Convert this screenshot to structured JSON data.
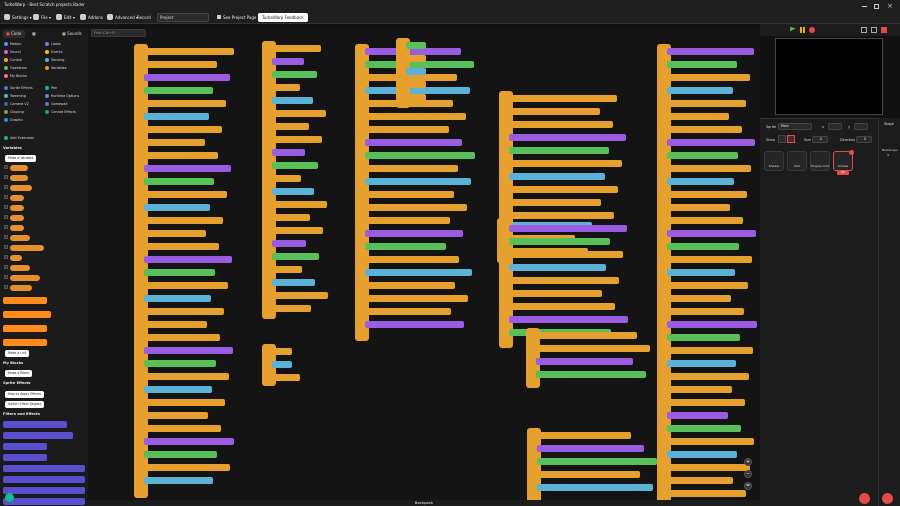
{
  "menubar": {
    "logo": "TurboWarp - Best Scratch projects Bader",
    "settings": "Settings",
    "file": "File",
    "edit": "Edit",
    "addons": "Addons",
    "advanced": "Advanced",
    "record": "Record",
    "project_title": "Project",
    "see_project_page": "See Project Page",
    "feedback": "TurboWarp Feedback"
  },
  "tabs": {
    "code": "Code",
    "costumes": "Costumes",
    "sounds": "Sounds"
  },
  "categories": [
    {
      "label": "Motion",
      "color": "#4c97ff"
    },
    {
      "label": "Looks",
      "color": "#9966ff"
    },
    {
      "label": "Sound",
      "color": "#cf63cf"
    },
    {
      "label": "Events",
      "color": "#ffbf00"
    },
    {
      "label": "Control",
      "color": "#ffab19"
    },
    {
      "label": "Sensing",
      "color": "#5cb1d6"
    },
    {
      "label": "Operators",
      "color": "#59c059"
    },
    {
      "label": "Variables",
      "color": "#ff8c1a"
    },
    {
      "label": "My Blocks",
      "color": "#ff6680"
    },
    {
      "label": "Sprite Effects",
      "color": "#3f7fd6"
    },
    {
      "label": "Pen",
      "color": "#0fbd8c"
    },
    {
      "label": "Tweening",
      "color": "#4fb2ce"
    },
    {
      "label": "Runtime Options",
      "color": "#5a8ad9"
    },
    {
      "label": "Camera V2",
      "color": "#3569a8"
    },
    {
      "label": "Gamepad",
      "color": "#6a6fd8"
    },
    {
      "label": "Clipping",
      "color": "#6aa84f"
    },
    {
      "label": "Conrad Effects",
      "color": "#1aa37a"
    },
    {
      "label": "Graphic",
      "color": "#0e9bd0"
    },
    {
      "label": "Add Extension",
      "color": "#0fbd8c"
    }
  ],
  "palette": {
    "variables_header": "Variables",
    "make_variable": "Make a Variable",
    "make_list": "Make a List",
    "my_blocks_header": "My Blocks",
    "make_block": "Make a Block",
    "sprite_effects_header": "Sprite Effects",
    "how_to_apply": "How to Apply Effects",
    "switch_effect_targets": "Switch Effect Targets",
    "filters_header": "Filters and Effects"
  },
  "workspace": {
    "search_placeholder": "Find (Ctrl+F)",
    "scrollbar_label": "Backpack"
  },
  "sprite_panel": {
    "sprite_label": "Sprite",
    "sprite_name": "Main",
    "x_label": "x",
    "y_label": "y",
    "show_label": "Show",
    "size_label": "Size",
    "direction_label": "Direction",
    "size_value": "0",
    "direction_value": "0",
    "thumbs": [
      "Shader",
      "Hell",
      "Engine Grid",
      "Smoke"
    ],
    "selected_thumb": "Smoke",
    "selected_sub": "BG"
  },
  "stage_panel": {
    "stage_label": "Stage",
    "backdrops_label": "Backdrops",
    "backdrops_count": "4"
  }
}
